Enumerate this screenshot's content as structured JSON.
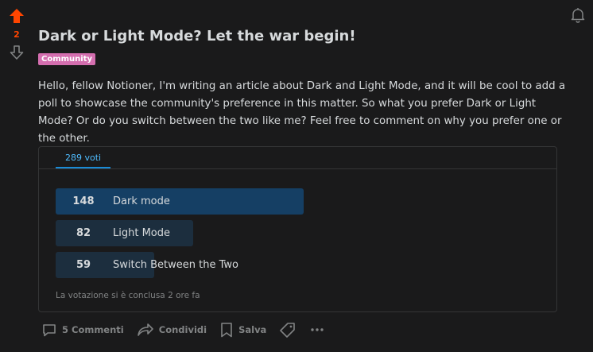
{
  "post": {
    "score": "2",
    "title": "Dark or Light Mode? Let the war begin!",
    "flair": "Community",
    "body": "Hello, fellow Notioner, I'm writing an article about Dark and Light Mode, and it will be cool to add a poll to showcase the community's preference in this matter. So what you prefer Dark or Light Mode? Or do you switch between the two like me? Feel free to comment on why you prefer one or the other."
  },
  "poll": {
    "tab_label": "289 voti",
    "options": [
      {
        "count": "148",
        "label": "Dark mode",
        "fraction": 0.512,
        "winner": true
      },
      {
        "count": "82",
        "label": "Light Mode",
        "fraction": 0.284,
        "winner": false
      },
      {
        "count": "59",
        "label": "Switch Between the Two",
        "fraction": 0.204,
        "winner": false
      }
    ],
    "footer": "La votazione si è conclusa 2 ore fa"
  },
  "actions": {
    "comments_label": "5 Commenti",
    "share_label": "Condividi",
    "save_label": "Salva"
  },
  "colors": {
    "upvote": "#ff4500",
    "flair_bg": "#d46eaf",
    "accent": "#4fbcff",
    "winner_bar": "#153f64",
    "bar": "#1c2e3e"
  }
}
